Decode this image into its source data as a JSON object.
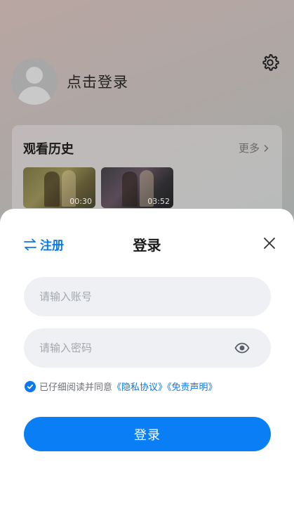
{
  "profile": {
    "login_prompt": "点击登录"
  },
  "history": {
    "title": "观看历史",
    "more_label": "更多",
    "items": [
      {
        "duration": "00:30"
      },
      {
        "duration": "03:52"
      }
    ]
  },
  "sheet": {
    "register_label": "注册",
    "title": "登录",
    "account_placeholder": "请输入账号",
    "password_placeholder": "请输入密码",
    "agreement_prefix": "已仔细阅读并同意",
    "privacy_link": "《隐私协议》",
    "disclaimer_link": "《免责声明》",
    "submit_label": "登录"
  },
  "colors": {
    "accent": "#0a7ff5",
    "field_bg": "#eef0f3"
  },
  "icons": {
    "settings": "gear-icon",
    "register": "swap-arrows-icon",
    "close": "close-icon",
    "password_toggle": "eye-icon",
    "more": "chevron-right-icon",
    "check": "check-icon"
  }
}
